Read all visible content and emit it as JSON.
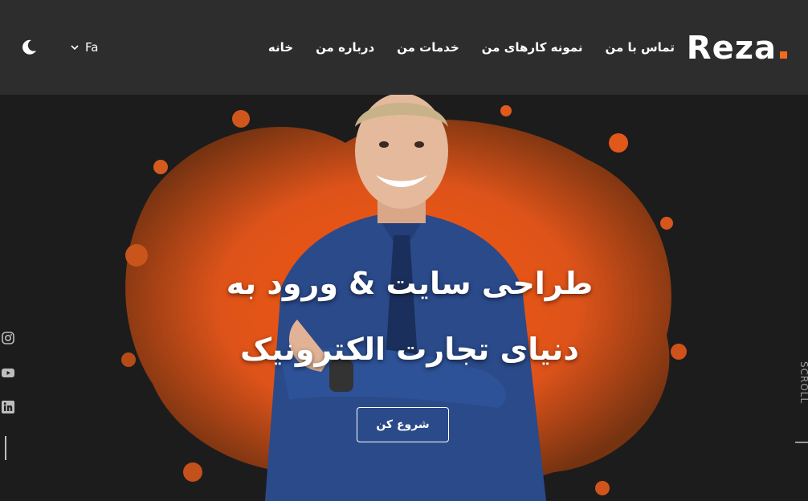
{
  "header": {
    "logo": "Reza",
    "nav": [
      {
        "label": "خانه"
      },
      {
        "label": "درباره من"
      },
      {
        "label": "خدمات من"
      },
      {
        "label": "نمونه کارهای من"
      },
      {
        "label": "تماس با من"
      }
    ],
    "language": "Fa",
    "theme_icon": "moon-icon"
  },
  "hero": {
    "headline_line1": "طراحی سایت & ورود به",
    "headline_line2": "دنیای تجارت الکترونیک",
    "cta_label": "شروع کن",
    "scroll_label": "SCROLL"
  },
  "social": [
    "instagram-icon",
    "youtube-icon",
    "linkedin-icon"
  ],
  "colors": {
    "accent": "#f26b1d",
    "header_bg": "#2d2d2d",
    "hero_bg": "#1c1c1c",
    "shirt": "#2a4a8a"
  }
}
